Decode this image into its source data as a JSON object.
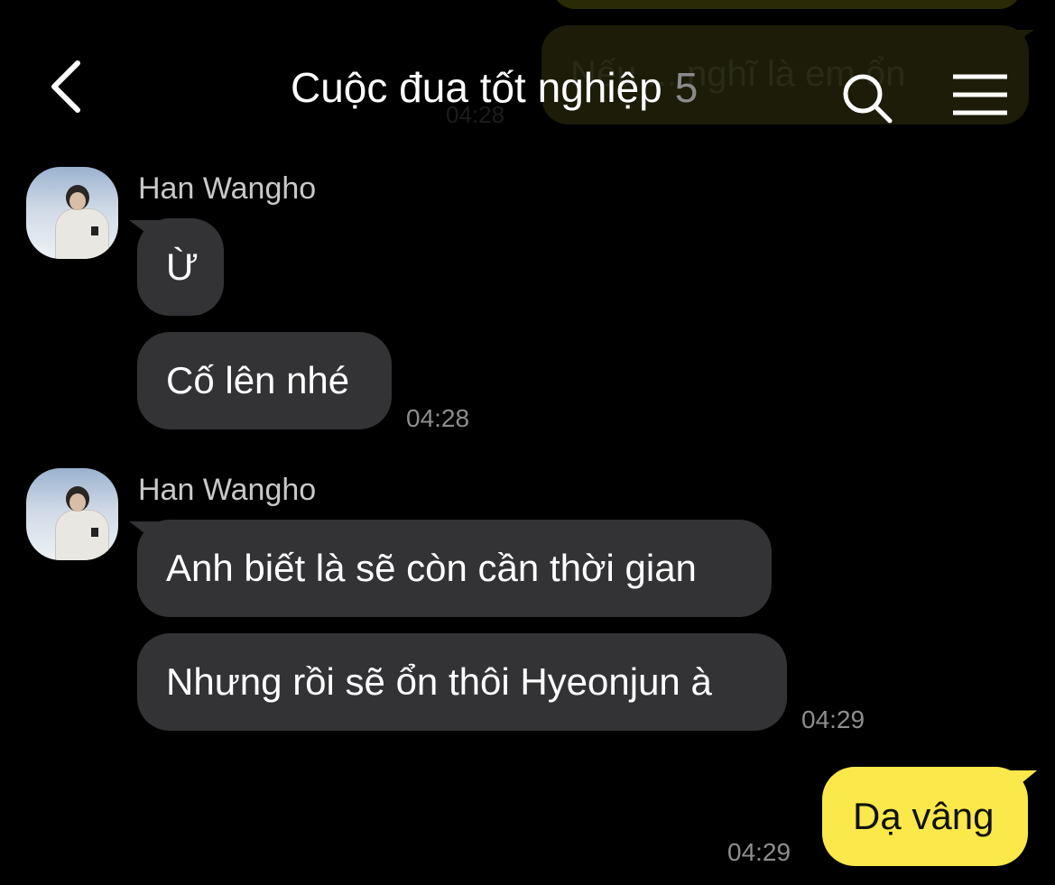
{
  "header": {
    "title": "Cuộc đua tốt nghiệp",
    "member_count": "5",
    "back_icon": "chevron-left-icon",
    "search_icon": "search-icon",
    "menu_icon": "hamburger-menu-icon"
  },
  "background": {
    "partial_message": "Nếu ... nghĩ là em ổn",
    "partial_time": "04:28"
  },
  "messages": [
    {
      "sender": "Han Wangho",
      "bubbles": [
        "Ừ",
        "Cố lên nhé"
      ],
      "time": "04:28"
    },
    {
      "sender": "Han Wangho",
      "bubbles": [
        "Anh biết là sẽ còn cần thời gian",
        "Nhưng rồi sẽ ổn thôi Hyeonjun à"
      ],
      "time": "04:29"
    }
  ],
  "my_message": {
    "text": "Dạ vâng",
    "time": "04:29"
  },
  "colors": {
    "background": "#000000",
    "incoming_bubble": "#333336",
    "outgoing_bubble": "#fbe84b",
    "timestamp": "#8e8e8e"
  }
}
